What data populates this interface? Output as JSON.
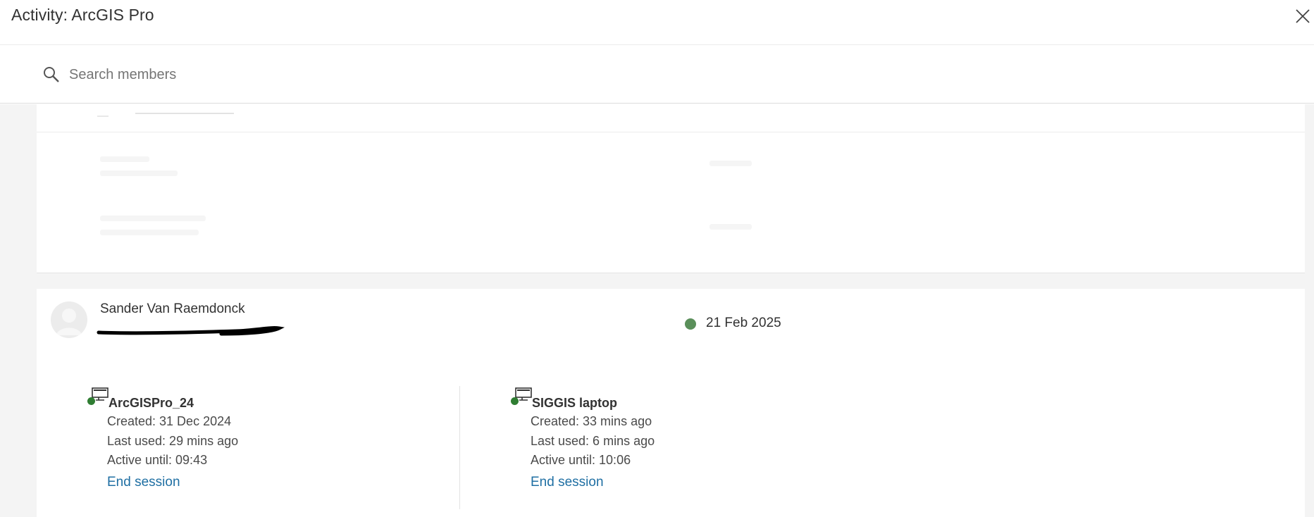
{
  "window": {
    "title": "Activity: ArcGIS Pro"
  },
  "search": {
    "placeholder": "Search members",
    "value": ""
  },
  "member": {
    "name": "Sander Van Raemdonck",
    "status_date": "21 Feb 2025",
    "status_color": "#5a8f5a"
  },
  "sessions": [
    {
      "name": "ArcGISPro_24",
      "created": "Created: 31 Dec 2024",
      "last_used": "Last used: 29 mins ago",
      "active_until": "Active until: 09:43",
      "end_label": "End session"
    },
    {
      "name": "SIGGIS laptop",
      "created": "Created: 33 mins ago",
      "last_used": "Last used: 6 mins ago",
      "active_until": "Active until: 10:06",
      "end_label": "End session"
    }
  ],
  "colors": {
    "link": "#1f6fa3",
    "online": "#2f7d32",
    "background": "#f4f4f4"
  },
  "icons": [
    "close-icon",
    "search-icon",
    "avatar-icon",
    "desktop-icon"
  ]
}
